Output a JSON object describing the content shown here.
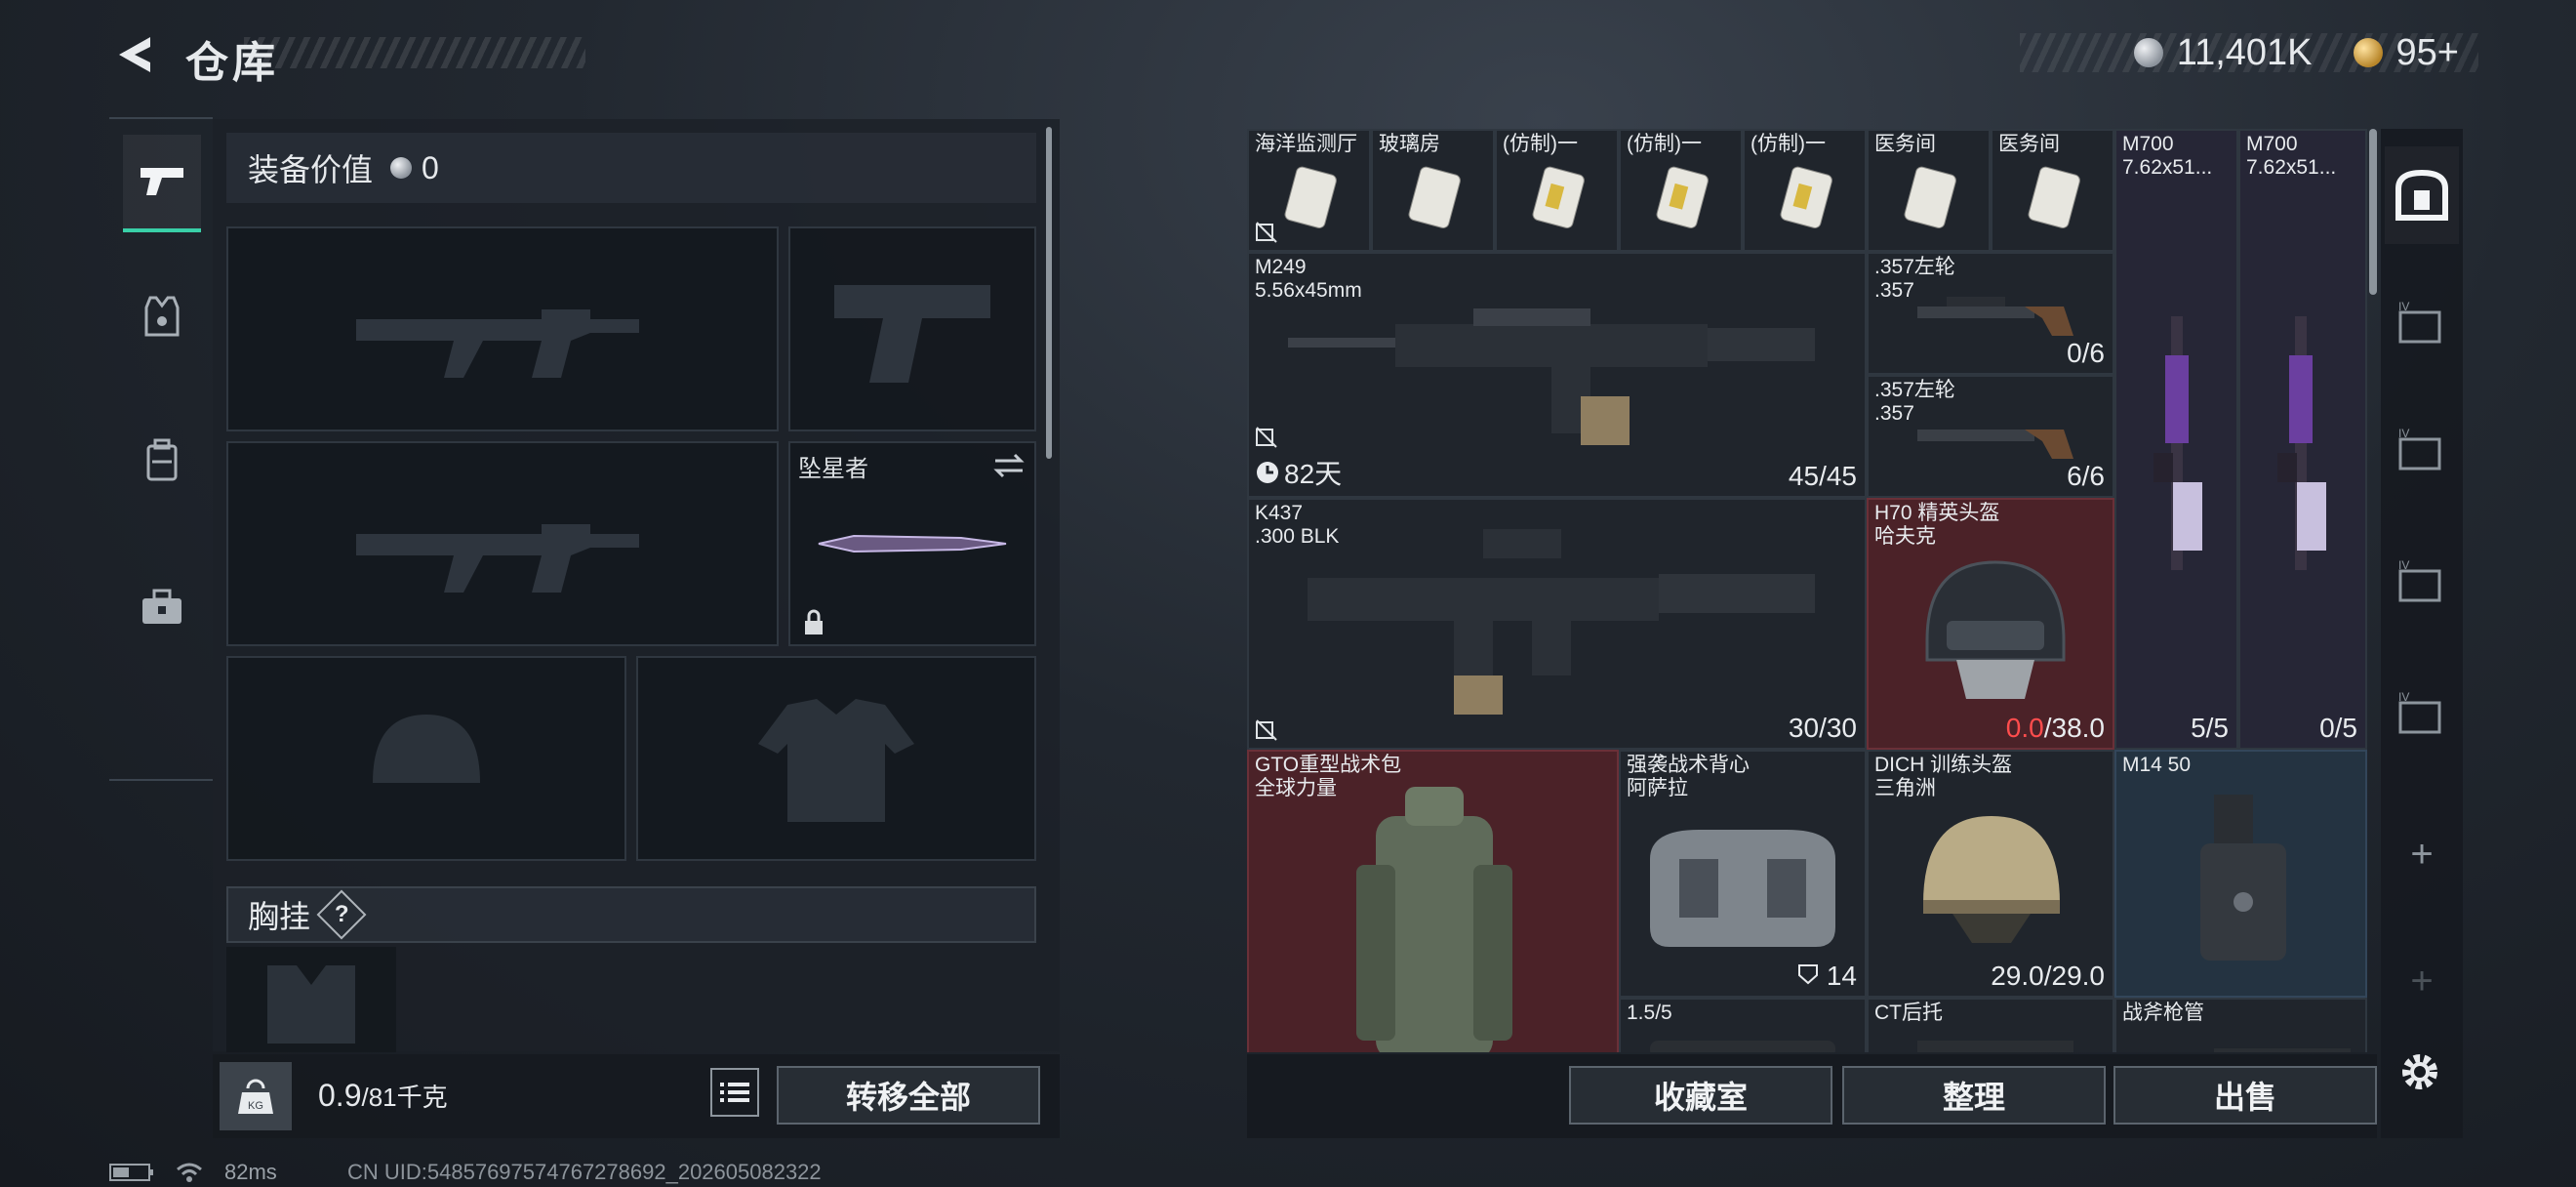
{
  "header": {
    "title": "仓库",
    "currency_silver": "11,401K",
    "currency_gold": "95+"
  },
  "left_tabs": [
    "weapon-tab",
    "armor-tab",
    "backpack-tab",
    "medkit-tab"
  ],
  "equipment": {
    "value_label": "装备价值",
    "value": "0",
    "melee_label": "坠星者",
    "chest_rig_label": "胸挂",
    "chest_rig_help": "?",
    "weight_value": "0.9",
    "weight_max": "/81千克",
    "weight_badge": "KG",
    "transfer_all": "转移全部"
  },
  "grid_items": [
    {
      "id": "c1",
      "name": "海洋监测厅",
      "color": "#c9c6b8"
    },
    {
      "id": "c2",
      "name": "玻璃房",
      "color": "#c9c6b8"
    },
    {
      "id": "c3",
      "name": "(仿制)一",
      "color": "#d8b840"
    },
    {
      "id": "c4",
      "name": "(仿制)一",
      "color": "#d8b840"
    },
    {
      "id": "c5",
      "name": "(仿制)一",
      "color": "#d8b840"
    },
    {
      "id": "c6",
      "name": "医务间",
      "color": "#c9c6b8"
    },
    {
      "id": "c7",
      "name": "医务间",
      "color": "#c9c6b8"
    },
    {
      "id": "m700a",
      "name": "M700",
      "sub": "7.62x51..."
    },
    {
      "id": "m700b",
      "name": "M700",
      "sub": "7.62x51..."
    },
    {
      "id": "m249",
      "name": "M249",
      "sub": "5.56x45mm",
      "timer": "82天",
      "count": "45/45"
    },
    {
      "id": "rev1",
      "name": ".357左轮",
      "sub": ".357",
      "count": "0/6"
    },
    {
      "id": "rev2",
      "name": ".357左轮",
      "sub": ".357",
      "count": "6/6"
    },
    {
      "id": "k437",
      "name": "K437",
      "sub": ".300 BLK",
      "count": "30/30"
    },
    {
      "id": "h70",
      "name": "H70 精英头盔",
      "sub": "哈夫克",
      "count_red": "0.0",
      "count_rest": "/38.0"
    },
    {
      "id": "mag1",
      "count": "5/5"
    },
    {
      "id": "mag2",
      "count": "0/5"
    },
    {
      "id": "gto",
      "name": "GTO重型战术包",
      "sub": "全球力量"
    },
    {
      "id": "vest",
      "name": "强袭战术背心",
      "sub": "阿萨拉",
      "count": "14"
    },
    {
      "id": "dich",
      "name": "DICH 训练头盔",
      "sub": "三角洲",
      "count": "29.0/29.0"
    },
    {
      "id": "m14",
      "name": "M14 50"
    },
    {
      "id": "scope",
      "name": "1.5/5"
    },
    {
      "id": "stock",
      "name": "CT后托"
    },
    {
      "id": "barrel",
      "name": "战斧枪管"
    }
  ],
  "actions": {
    "collection": "收藏室",
    "sort": "整理",
    "sell": "出售"
  },
  "right_side": {
    "plus": "+"
  },
  "status": {
    "ping": "82ms",
    "uid": "CN UID:54857697574767278692_202605082322"
  }
}
